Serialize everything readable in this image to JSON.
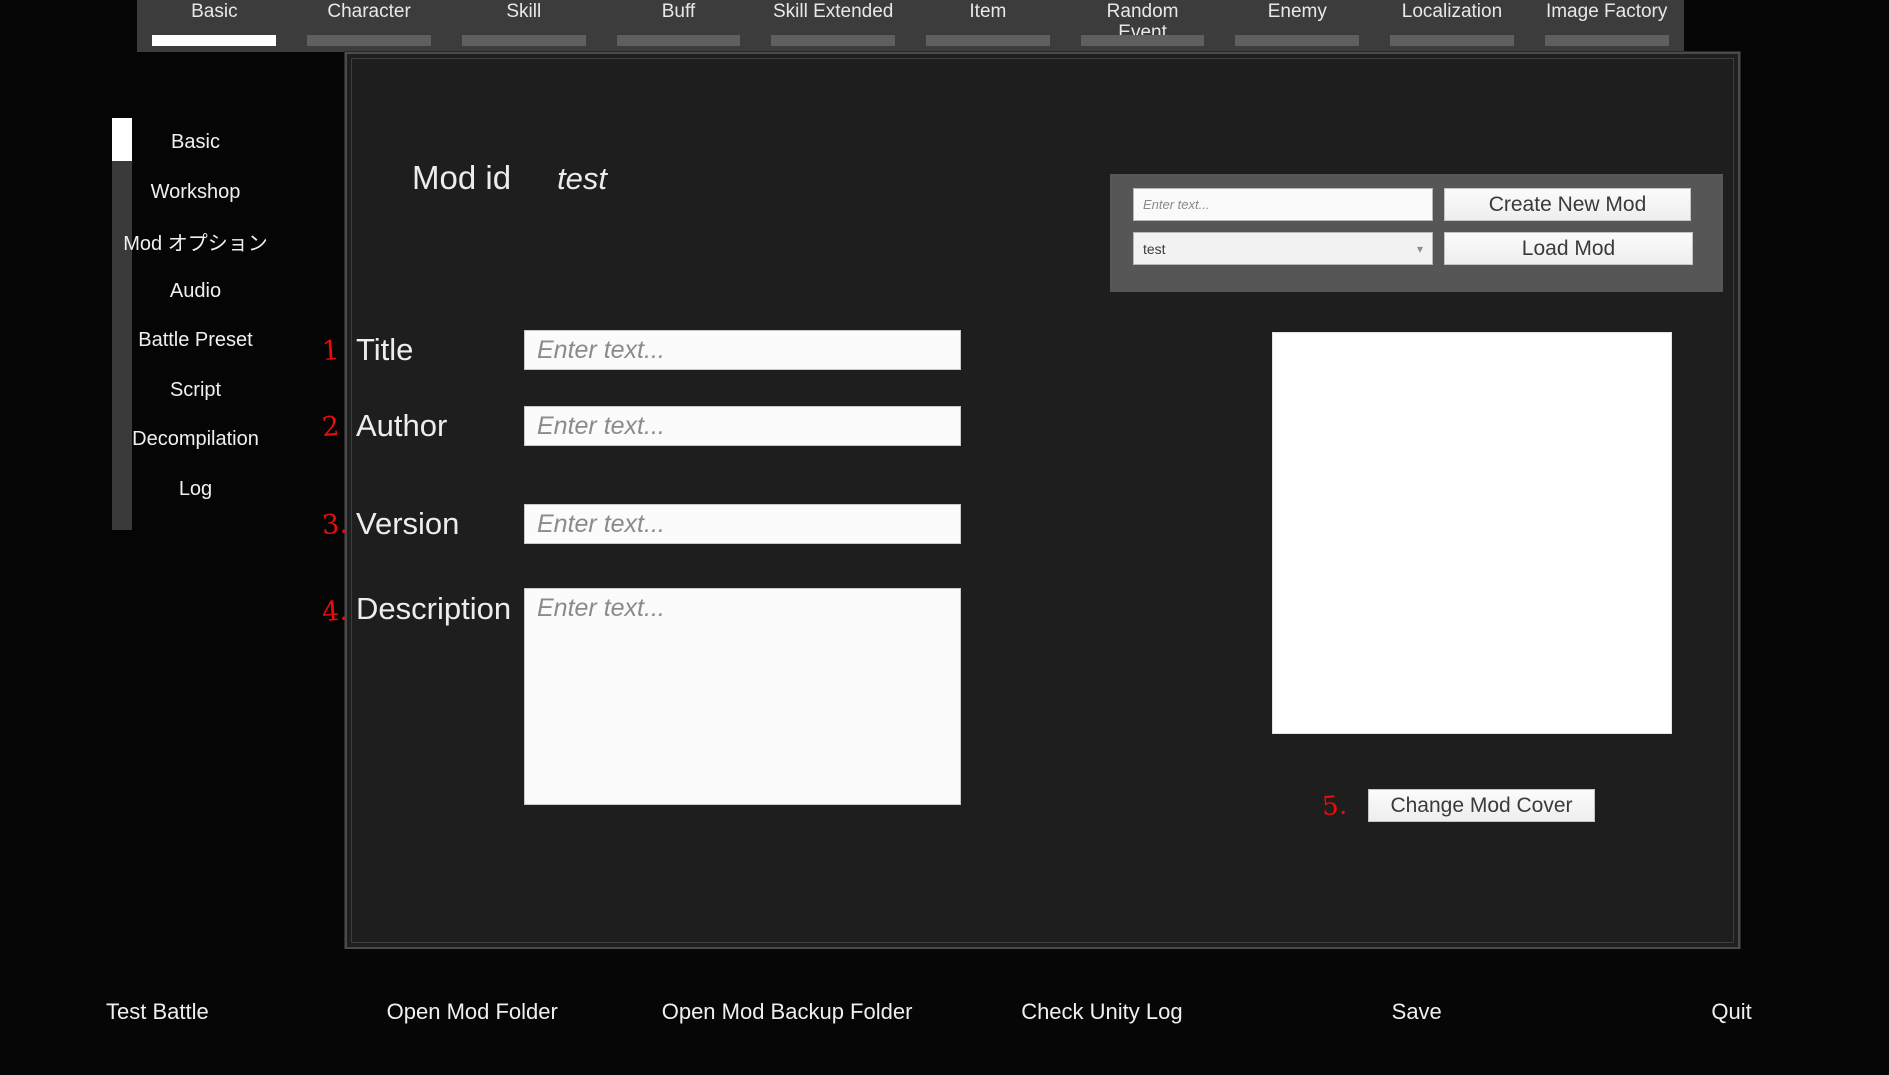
{
  "tabs": [
    {
      "label": "Basic",
      "active": true
    },
    {
      "label": "Character",
      "active": false
    },
    {
      "label": "Skill",
      "active": false
    },
    {
      "label": "Buff",
      "active": false
    },
    {
      "label": "Skill Extended",
      "active": false
    },
    {
      "label": "Item",
      "active": false
    },
    {
      "label": "Random\nEvent",
      "active": false
    },
    {
      "label": "Enemy",
      "active": false
    },
    {
      "label": "Localization",
      "active": false
    },
    {
      "label": "Image Factory",
      "active": false
    }
  ],
  "sidebar": {
    "items": [
      {
        "label": "Basic",
        "selected": true
      },
      {
        "label": "Workshop",
        "selected": false
      },
      {
        "label": "Mod オプション",
        "selected": false
      },
      {
        "label": "Audio",
        "selected": false
      },
      {
        "label": "Battle Preset",
        "selected": false
      },
      {
        "label": "Script",
        "selected": false
      },
      {
        "label": "Decompilation",
        "selected": false
      },
      {
        "label": "Log",
        "selected": false
      }
    ]
  },
  "mod_header": {
    "label": "Mod id",
    "value": "test"
  },
  "create_panel": {
    "new_mod_placeholder": "Enter text...",
    "new_mod_value": "",
    "create_button": "Create New Mod",
    "mod_select_value": "test",
    "caret_icon": "chevron-down-icon",
    "load_button": "Load Mod"
  },
  "form": {
    "fields": [
      {
        "num": "1",
        "label": "Title",
        "placeholder": "Enter text...",
        "value": ""
      },
      {
        "num": "2",
        "label": "Author",
        "placeholder": "Enter text...",
        "value": ""
      },
      {
        "num": "3.",
        "label": "Version",
        "placeholder": "Enter text...",
        "value": ""
      },
      {
        "num": "4.",
        "label": "Description",
        "placeholder": "Enter text...",
        "value": ""
      }
    ]
  },
  "cover": {
    "annotation_num": "5.",
    "change_button": "Change Mod Cover"
  },
  "bottom_bar": {
    "items": [
      {
        "label": "Test Battle"
      },
      {
        "label": "Open Mod Folder"
      },
      {
        "label": "Open Mod Backup Folder"
      },
      {
        "label": "Check Unity Log"
      },
      {
        "label": "Save"
      },
      {
        "label": "Quit"
      }
    ]
  },
  "colors": {
    "background": "#050505",
    "tabbar": "#3c3c3c",
    "panel": "#1e1e1e",
    "accent_active": "#ffffff",
    "annotation_red": "#f00b0b",
    "create_panel_bg": "#565656"
  }
}
